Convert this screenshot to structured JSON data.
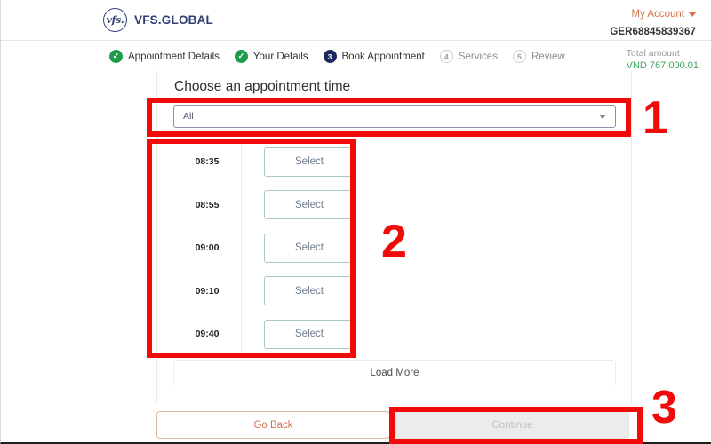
{
  "header": {
    "logo_mark": "vfs.",
    "logo_icon": "vfs-circle-logo",
    "brand_name": "VFS.GLOBAL",
    "my_account_label": "My Account",
    "my_account_caret_icon": "chevron-down-icon",
    "reference_number": "GER68845839367"
  },
  "stepper": {
    "steps": [
      {
        "badge": "✓",
        "label": "Appointment Details",
        "state": "done"
      },
      {
        "badge": "✓",
        "label": "Your Details",
        "state": "done"
      },
      {
        "badge": "3",
        "label": "Book Appointment",
        "state": "current"
      },
      {
        "badge": "4",
        "label": "Services",
        "state": "todo"
      },
      {
        "badge": "5",
        "label": "Review",
        "state": "todo"
      }
    ]
  },
  "total": {
    "label": "Total amount",
    "value": "VND 767,000.01",
    "color": "#3aa35f"
  },
  "card": {
    "title": "Choose an appointment time",
    "filter": {
      "selected": "All",
      "caret_icon": "chevron-down-icon"
    },
    "slots": [
      {
        "time": "08:35",
        "button": "Select"
      },
      {
        "time": "08:55",
        "button": "Select"
      },
      {
        "time": "09:00",
        "button": "Select"
      },
      {
        "time": "09:10",
        "button": "Select"
      },
      {
        "time": "09:40",
        "button": "Select"
      }
    ],
    "load_more_label": "Load More"
  },
  "footer": {
    "back_label": "Go Back",
    "continue_label": "Continue"
  },
  "annotations": {
    "color": "#f10a0a",
    "markers": [
      {
        "number": "1",
        "target": "appointment-time-filter"
      },
      {
        "number": "2",
        "target": "time-slot-list"
      },
      {
        "number": "3",
        "target": "continue-button"
      }
    ]
  }
}
